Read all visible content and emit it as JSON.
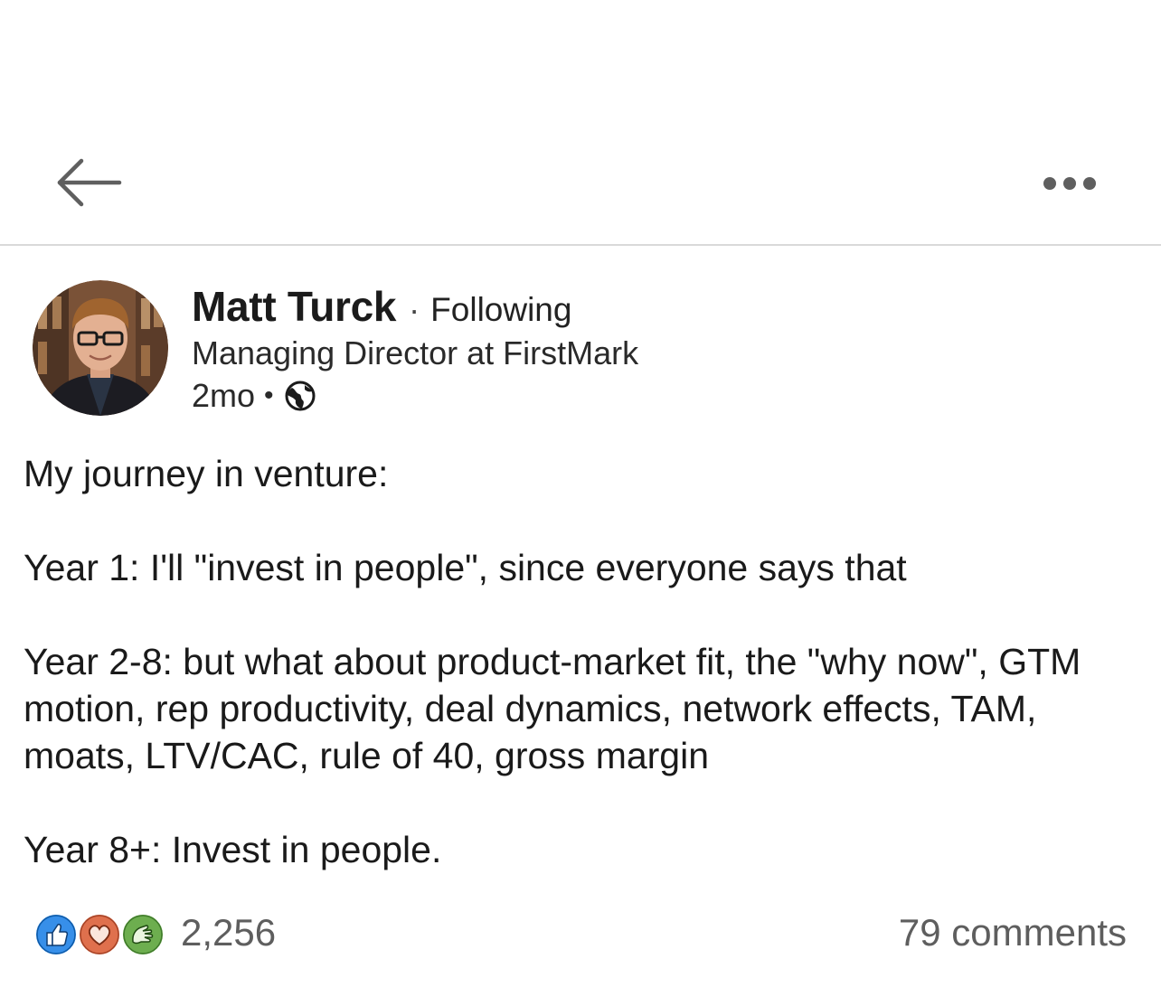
{
  "header": {
    "back_icon": "arrow-left-icon",
    "more_icon": "more-horizontal-icon"
  },
  "post": {
    "author": {
      "name": "Matt Turck",
      "separator": "·",
      "connection_status": "Following",
      "headline": "Managing Director at FirstMark",
      "avatar": "profile-photo"
    },
    "meta": {
      "time": "2mo",
      "separator": "•",
      "visibility_icon": "globe-icon"
    },
    "body": [
      "My journey in venture:",
      "Year 1: I'll \"invest in people\", since everyone says that",
      "Year 2-8: but what about product-market fit, the \"why now\", GTM motion, rep productivity, deal dynamics, network effects, TAM, moats, LTV/CAC, rule of 40, gross margin",
      "Year 8+: Invest in people."
    ],
    "social": {
      "reaction_icons": [
        "like-icon",
        "love-icon",
        "celebrate-icon"
      ],
      "colors": {
        "like": "#378fe9",
        "love": "#df704d",
        "celebrate": "#6dae4f"
      },
      "reaction_count": "2,256",
      "comments": "79 comments"
    }
  }
}
